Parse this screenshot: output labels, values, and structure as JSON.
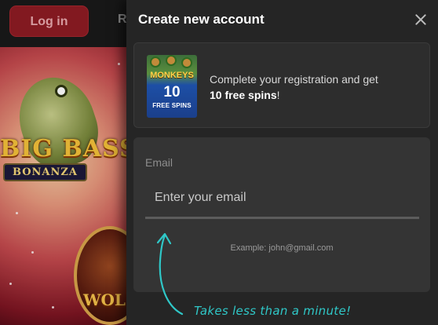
{
  "header": {
    "login_label": "Log in",
    "register_partial": "R"
  },
  "background_games": {
    "game1_line1": "BIG BASS",
    "game1_line2": "BONANZA",
    "game2_text": "WOL GOL"
  },
  "modal": {
    "title": "Create new account",
    "close_icon": "close-icon",
    "promo": {
      "thumb_brand": "MONKEYS",
      "thumb_number": "10",
      "thumb_caption": "FREE SPINS",
      "text_prefix": "Complete your registration and get",
      "text_bold": "10 free spins",
      "text_suffix": "!"
    },
    "form": {
      "email_label": "Email",
      "email_placeholder": "Enter your email",
      "email_value": "",
      "email_hint": "Example: john@gmail.com"
    },
    "annotation": "Takes less than a minute!"
  },
  "colors": {
    "login_bg": "#8e1c23",
    "modal_bg": "#252525",
    "card_bg": "#343434",
    "annotation": "#2fc7c7"
  }
}
